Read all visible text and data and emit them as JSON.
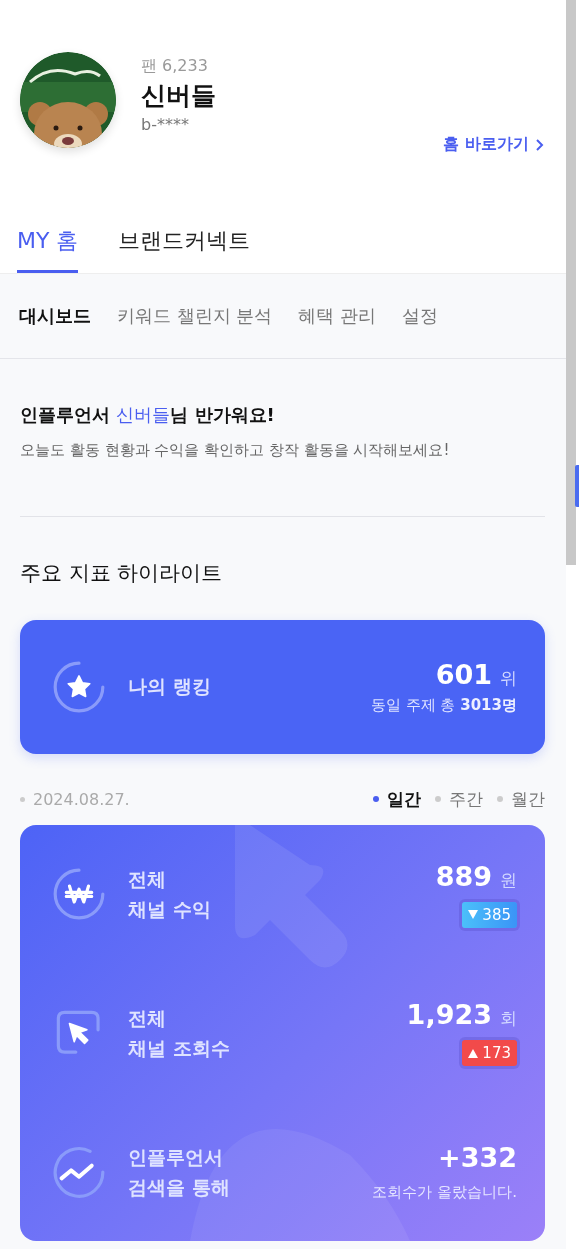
{
  "profile": {
    "fans": "팬 6,233",
    "name": "신버들",
    "handle": "b-****",
    "home_link": "홈 바로가기"
  },
  "tabs": [
    {
      "label": "MY 홈",
      "selected": true
    },
    {
      "label": "브랜드커넥트",
      "selected": false
    }
  ],
  "sub_tabs": [
    {
      "label": "대시보드",
      "selected": true
    },
    {
      "label": "키워드 챌린지 분석",
      "selected": false
    },
    {
      "label": "혜택 관리",
      "selected": false
    },
    {
      "label": "설정",
      "selected": false
    }
  ],
  "greeting": {
    "before": "인플루언서 ",
    "name": "신버들",
    "after": "님 반가워요!",
    "message": "오늘도 활동 현황과 수익을 확인하고 창작 활동을 시작해보세요!"
  },
  "section_title": "주요 지표 하이라이트",
  "ranking": {
    "label": "나의 랭킹",
    "value": "601",
    "unit": "위",
    "note_prefix": "동일 주제 총 ",
    "note_total": "3013명"
  },
  "date": "2024.08.27.",
  "periods": [
    {
      "label": "일간",
      "selected": true
    },
    {
      "label": "주간",
      "selected": false
    },
    {
      "label": "월간",
      "selected": false
    }
  ],
  "metrics": [
    {
      "kind": "revenue",
      "line1": "전체",
      "line2": "채널 수익",
      "value": "889",
      "unit": "원",
      "change": {
        "kind": "down",
        "amount": "385"
      }
    },
    {
      "kind": "views",
      "line1": "전체",
      "line2": "채널 조회수",
      "value": "1,923",
      "unit": "회",
      "change": {
        "kind": "up",
        "amount": "173"
      }
    },
    {
      "kind": "search",
      "line1": "인플루언서",
      "line2": "검색을 통해",
      "value": "+332",
      "note": "조회수가 올랐습니다."
    }
  ]
}
